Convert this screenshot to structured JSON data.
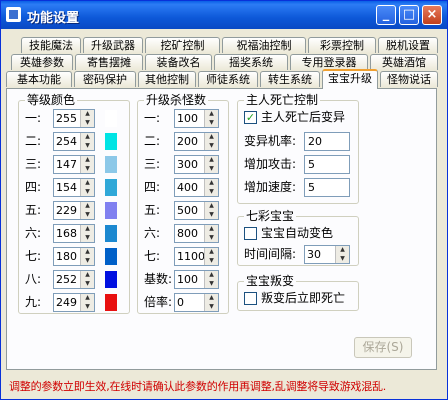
{
  "window": {
    "title": "功能设置"
  },
  "tabs": {
    "row1": [
      "技能魔法",
      "升级武器",
      "挖矿控制",
      "祝福油控制",
      "彩票控制",
      "脱机设置"
    ],
    "row2": [
      "英雄参数",
      "寄售摆摊",
      "装备改名",
      "摇奖系统",
      "专用登录器",
      "英雄酒馆"
    ],
    "row3": [
      "基本功能",
      "密码保护",
      "其他控制",
      "师徒系统",
      "转生系统",
      "宝宝升级",
      "怪物说话"
    ],
    "active": "宝宝升级"
  },
  "level_color": {
    "title": "等级颜色",
    "rows": [
      {
        "label": "一:",
        "value": "255",
        "color": "#ffffff"
      },
      {
        "label": "二:",
        "value": "254",
        "color": "#00e4e4"
      },
      {
        "label": "三:",
        "value": "147",
        "color": "#8cc8e8"
      },
      {
        "label": "四:",
        "value": "154",
        "color": "#30a8d8"
      },
      {
        "label": "五:",
        "value": "229",
        "color": "#8080f0"
      },
      {
        "label": "六:",
        "value": "168",
        "color": "#1c88d0"
      },
      {
        "label": "七:",
        "value": "180",
        "color": "#0060c8"
      },
      {
        "label": "八:",
        "value": "252",
        "color": "#0010e0"
      },
      {
        "label": "九:",
        "value": "249",
        "color": "#e81010"
      }
    ]
  },
  "kill_count": {
    "title": "升级杀怪数",
    "rows": [
      {
        "label": "一:",
        "value": "100"
      },
      {
        "label": "二:",
        "value": "200"
      },
      {
        "label": "三:",
        "value": "300"
      },
      {
        "label": "四:",
        "value": "400"
      },
      {
        "label": "五:",
        "value": "500"
      },
      {
        "label": "六:",
        "value": "800"
      },
      {
        "label": "七:",
        "value": "1100"
      },
      {
        "label": "基数:",
        "value": "100"
      },
      {
        "label": "倍率:",
        "value": "0"
      }
    ]
  },
  "master_death": {
    "title": "主人死亡控制",
    "checkbox_label": "主人死亡后变异",
    "checked": true,
    "fields": [
      {
        "label": "变异机率:",
        "value": "20"
      },
      {
        "label": "增加攻击:",
        "value": "5"
      },
      {
        "label": "增加速度:",
        "value": "5"
      }
    ]
  },
  "seven_color": {
    "title": "七彩宝宝",
    "checkbox_label": "宝宝自动变色",
    "checked": false,
    "interval_label": "时间间隔:",
    "interval_value": "30"
  },
  "rebel": {
    "title": "宝宝叛变",
    "checkbox_label": "叛变后立即死亡",
    "checked": false
  },
  "save_button": {
    "label": "保存(S)"
  },
  "status_text": "调整的参数立即生效,在线时请确认此参数的作用再调整,乱调整将导致游戏混乱."
}
